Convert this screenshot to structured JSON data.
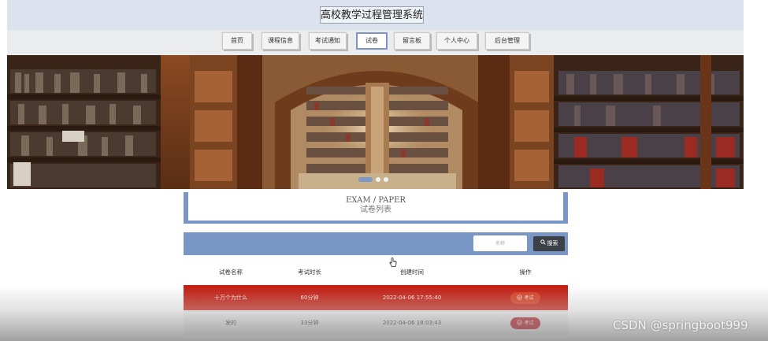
{
  "site": {
    "title": "高校教学过程管理系统"
  },
  "nav": {
    "items": [
      {
        "label": "首页"
      },
      {
        "label": "课程信息"
      },
      {
        "label": "考试通知"
      },
      {
        "label": "试卷",
        "active": true
      },
      {
        "label": "留言板"
      },
      {
        "label": "个人中心"
      },
      {
        "label": "后台管理"
      }
    ]
  },
  "carousel": {
    "slide_count": 3,
    "active_slide": 1
  },
  "section": {
    "title_en": "EXAM / PAPER",
    "title_cn": "试卷列表"
  },
  "search": {
    "placeholder": "名称",
    "button_label": "搜索",
    "button_icon": "search-icon"
  },
  "table": {
    "columns": [
      "试卷名称",
      "考试时长",
      "创建时间",
      "操作"
    ],
    "rows": [
      {
        "name": "十万个为什么",
        "duration": "60分钟",
        "created": "2022-04-06 17:55:40",
        "action": "考试",
        "action_icon": "check-circle-icon"
      },
      {
        "name": "发的",
        "duration": "33分钟",
        "created": "2022-04-06 18:03:43",
        "action": "考试",
        "action_icon": "check-circle-icon"
      }
    ]
  },
  "colors": {
    "accent": "#7a96c6",
    "highlight_row": "#c41a0e",
    "exam_button": "#c0151f",
    "topbar": "#dde3ee"
  },
  "watermark": {
    "text": "CSDN @springboot999"
  }
}
